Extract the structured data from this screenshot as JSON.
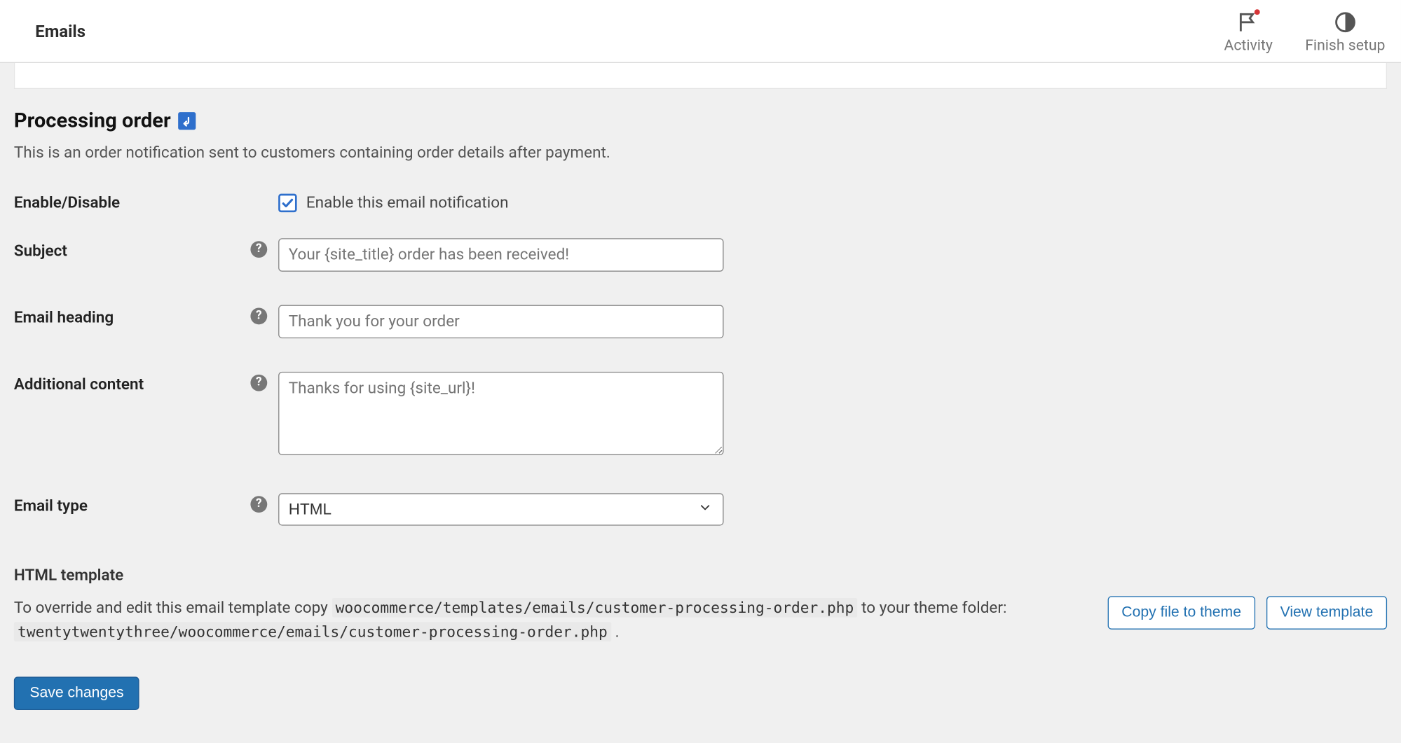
{
  "topbar": {
    "title": "Emails",
    "activity_label": "Activity",
    "finish_label": "Finish setup"
  },
  "page": {
    "heading": "Processing order",
    "description": "This is an order notification sent to customers containing order details after payment."
  },
  "fields": {
    "enable": {
      "label": "Enable/Disable",
      "checkbox_label": "Enable this email notification",
      "checked": true
    },
    "subject": {
      "label": "Subject",
      "placeholder": "Your {site_title} order has been received!",
      "value": ""
    },
    "heading": {
      "label": "Email heading",
      "placeholder": "Thank you for your order",
      "value": ""
    },
    "additional": {
      "label": "Additional content",
      "placeholder": "Thanks for using {site_url}!",
      "value": ""
    },
    "type": {
      "label": "Email type",
      "value": "HTML"
    }
  },
  "template": {
    "heading": "HTML template",
    "prefix": "To override and edit this email template copy",
    "src_path": "woocommerce/templates/emails/customer-processing-order.php",
    "mid": "to your theme folder:",
    "dest_path": "twentytwentythree/woocommerce/emails/customer-processing-order.php",
    "suffix": ".",
    "copy_label": "Copy file to theme",
    "view_label": "View template"
  },
  "actions": {
    "save_label": "Save changes"
  }
}
